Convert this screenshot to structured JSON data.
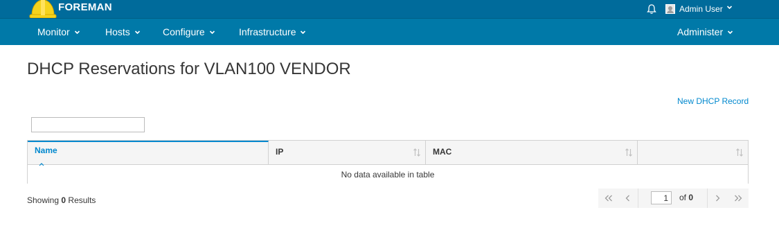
{
  "header": {
    "brand": "FOREMAN",
    "user_name": "Admin User"
  },
  "nav": {
    "items": [
      "Monitor",
      "Hosts",
      "Configure",
      "Infrastructure"
    ],
    "right_item": "Administer"
  },
  "page": {
    "title": "DHCP Reservations for VLAN100 VENDOR",
    "new_record_label": "New DHCP Record",
    "search": {
      "value": "",
      "placeholder": ""
    }
  },
  "table": {
    "columns": [
      "Name",
      "IP",
      "MAC",
      ""
    ],
    "sorted_column": "Name",
    "empty_message": "No data available in table"
  },
  "footer": {
    "showing_prefix": "Showing",
    "result_count": "0",
    "results_suffix": "Results"
  },
  "pagination": {
    "current_page": "1",
    "of_label": "of",
    "total_pages": "0"
  },
  "colors": {
    "topbar": "#006b9b",
    "navbar": "#0079a8",
    "link": "#0088ce"
  },
  "icons": {
    "logo": "foreman-hardhat-icon",
    "notification": "bell-icon",
    "avatar": "user-avatar-icon",
    "sort": "sort-arrows-icon",
    "first": "first-page-icon",
    "prev": "previous-page-icon",
    "next": "next-page-icon",
    "last": "last-page-icon"
  }
}
